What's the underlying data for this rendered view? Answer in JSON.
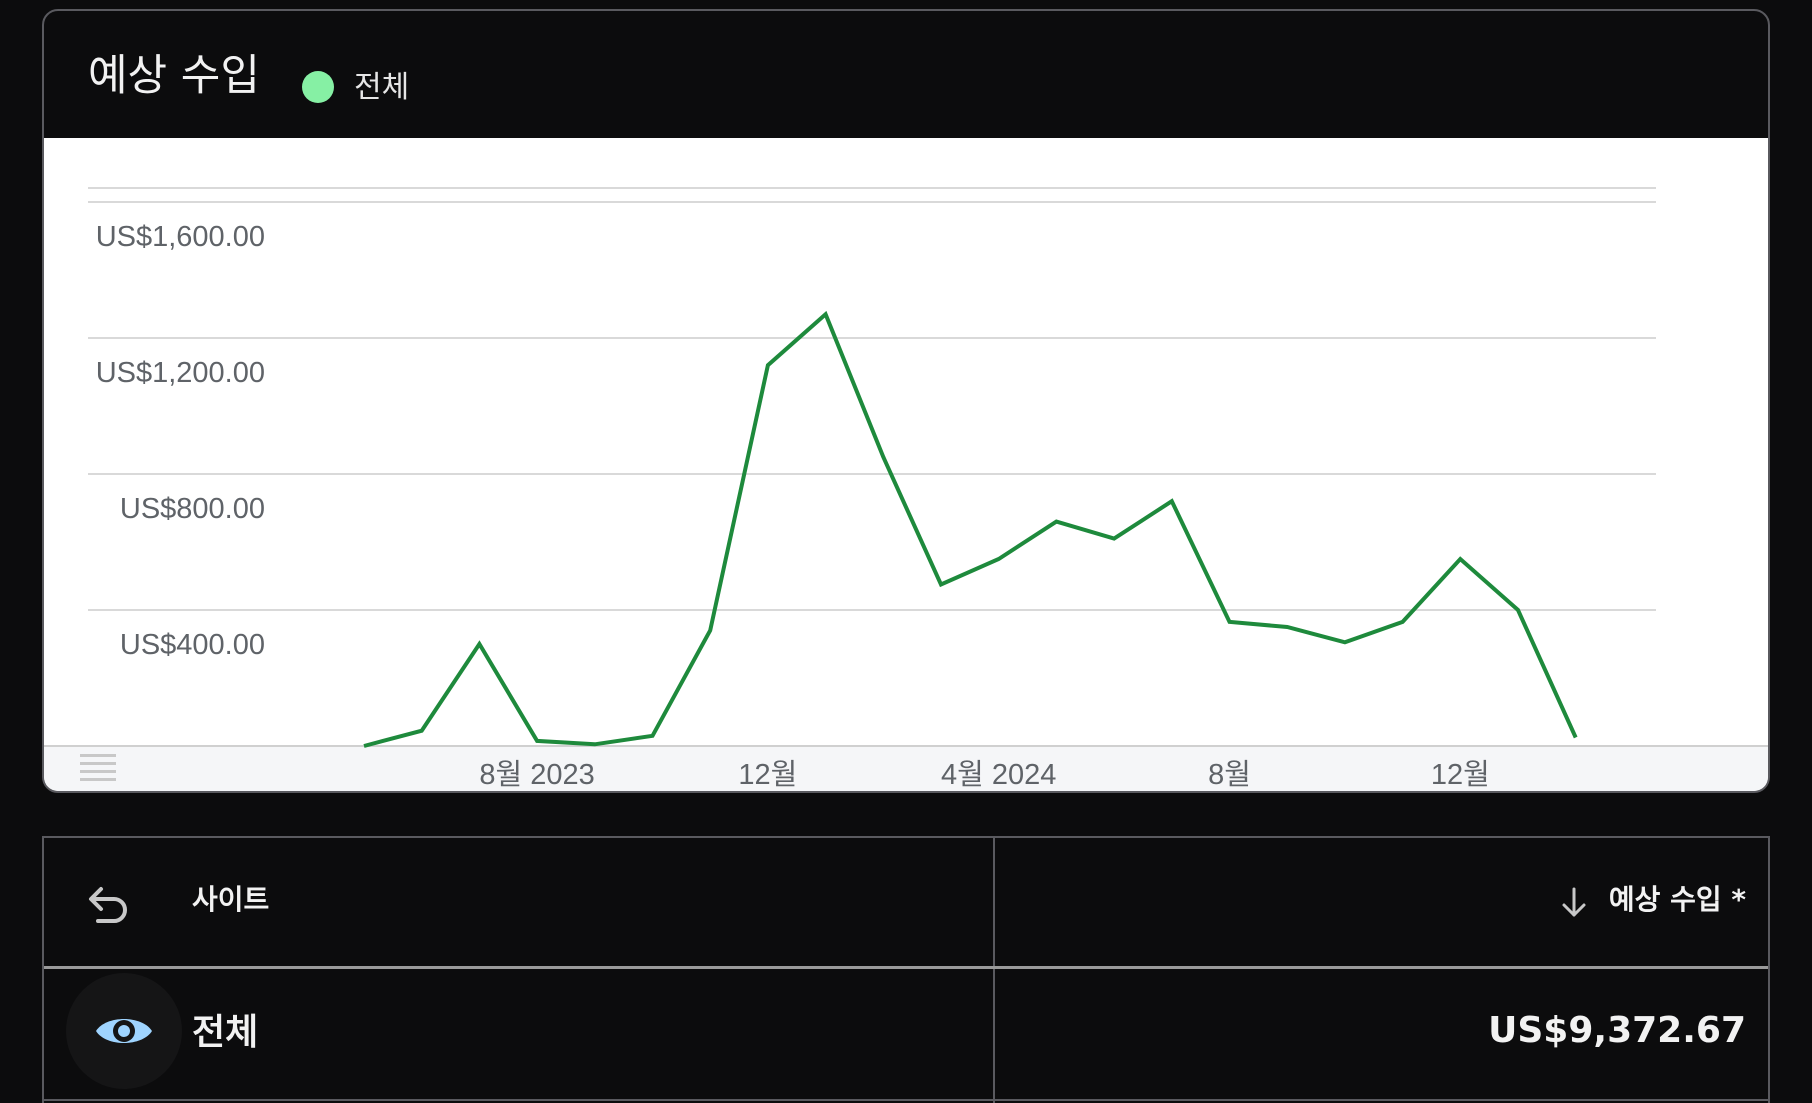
{
  "card": {
    "title": "예상 수입",
    "legend_label": "전체",
    "legend_color": "#86f0a4"
  },
  "chart_data": {
    "type": "line",
    "title": "예상 수입",
    "y_tick_labels": [
      "US$400.00",
      "US$800.00",
      "US$1,200.00",
      "US$1,600.00"
    ],
    "y_ticks": [
      400,
      800,
      1200,
      1600
    ],
    "ylim": [
      0,
      1600
    ],
    "x_tick_labels": [
      "8월 2023",
      "12월",
      "4월 2024",
      "8월",
      "12월"
    ],
    "x_ticks": [
      "2023-08",
      "2023-12",
      "2024-04",
      "2024-08",
      "2024-12"
    ],
    "x": [
      "2023-05",
      "2023-06",
      "2023-07",
      "2023-08",
      "2023-09",
      "2023-10",
      "2023-11",
      "2023-12",
      "2024-01",
      "2024-02",
      "2024-03",
      "2024-04",
      "2024-05",
      "2024-06",
      "2024-07",
      "2024-08",
      "2024-09",
      "2024-10",
      "2024-11",
      "2024-12",
      "2025-01",
      "2025-02"
    ],
    "series": [
      {
        "name": "전체",
        "color": "#1e8a3c",
        "values": [
          0,
          45,
          300,
          15,
          5,
          30,
          340,
          1120,
          1270,
          850,
          475,
          550,
          660,
          610,
          720,
          365,
          350,
          305,
          365,
          550,
          400,
          25
        ]
      }
    ],
    "grid": true,
    "legend": "top-left"
  },
  "table": {
    "col_site": "사이트",
    "col_revenue": "예상 수입 *",
    "rows": [
      {
        "site": "전체",
        "revenue": "US$9,372.67"
      }
    ]
  },
  "icons": {
    "back": "back-arrow-icon",
    "sort": "arrow-down-icon",
    "visibility": "eye-icon",
    "chart_menu": "menu-lines-icon"
  },
  "colors": {
    "eye": "#9fd4ff",
    "line": "#1e8a3c"
  }
}
